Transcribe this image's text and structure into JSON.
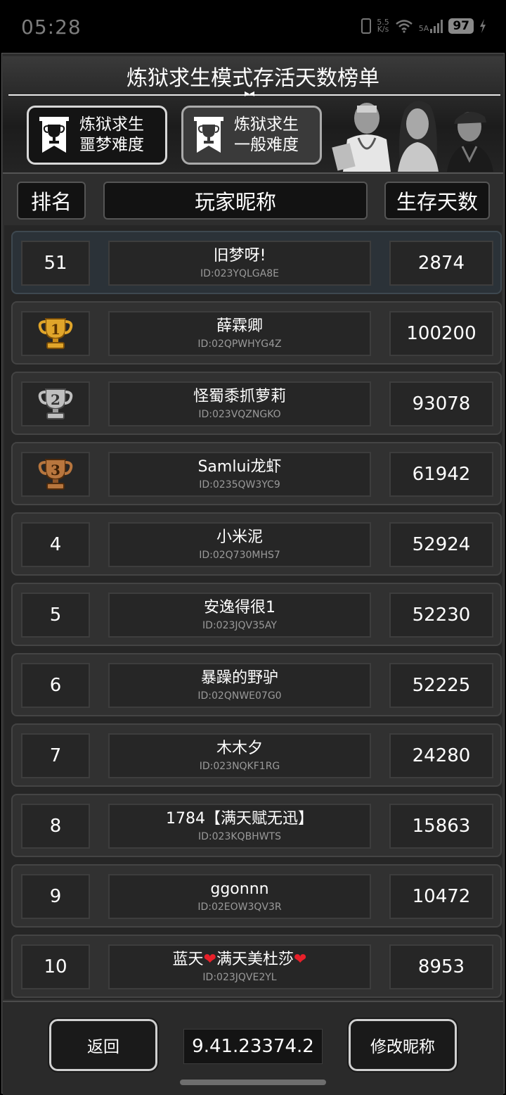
{
  "status_bar": {
    "time": "05:28",
    "net_speed_top": "5.5",
    "net_speed_bottom": "K/s",
    "sim_label": "5A",
    "battery": "97"
  },
  "header": {
    "title": "炼狱求生模式存活天数榜单",
    "difficulty_buttons": [
      {
        "line1": "炼狱求生",
        "line2": "噩梦难度"
      },
      {
        "line1": "炼狱求生",
        "line2": "一般难度"
      }
    ]
  },
  "columns": {
    "rank": "排名",
    "nickname": "玩家昵称",
    "days": "生存天数"
  },
  "my_row": {
    "rank": "51",
    "name": "旧梦呀!",
    "id": "ID:023YQLGA8E",
    "days": "2874"
  },
  "rows": [
    {
      "rank": "1",
      "medal": "gold",
      "name": "薛霖卿",
      "id": "ID:02QPWHYG4Z",
      "days": "100200"
    },
    {
      "rank": "2",
      "medal": "silver",
      "name": "怪蜀黍抓萝莉",
      "id": "ID:023VQZNGKO",
      "days": "93078"
    },
    {
      "rank": "3",
      "medal": "bronze",
      "name": "Samlui龙虾",
      "id": "ID:0235QW3YC9",
      "days": "61942"
    },
    {
      "rank": "4",
      "name": "小米泥",
      "id": "ID:02Q730MHS7",
      "days": "52924"
    },
    {
      "rank": "5",
      "name": "安逸得很1",
      "id": "ID:023JQV35AY",
      "days": "52230"
    },
    {
      "rank": "6",
      "name": "暴躁的野驴",
      "id": "ID:02QNWE07G0",
      "days": "52225"
    },
    {
      "rank": "7",
      "name": "木木夕",
      "id": "ID:023NQKF1RG",
      "days": "24280"
    },
    {
      "rank": "8",
      "name": "1784【满天赋无迅】",
      "id": "ID:023KQBHWTS",
      "days": "15863"
    },
    {
      "rank": "9",
      "name": "ggonnn",
      "id": "ID:02EOW3QV3R",
      "days": "10472"
    },
    {
      "rank": "10",
      "name_parts": [
        "蓝天",
        "满天美杜莎",
        ""
      ],
      "name": "蓝天❤满天美杜莎❤",
      "id": "ID:023JQVE2YL",
      "days": "8953"
    }
  ],
  "footer": {
    "back_label": "返回",
    "version": "9.41.23374.2",
    "rename_label": "修改昵称"
  },
  "colors": {
    "gold": "#e0a52a",
    "silver": "#bfbfbf",
    "bronze": "#b8763e",
    "heart": "#e8202a"
  }
}
